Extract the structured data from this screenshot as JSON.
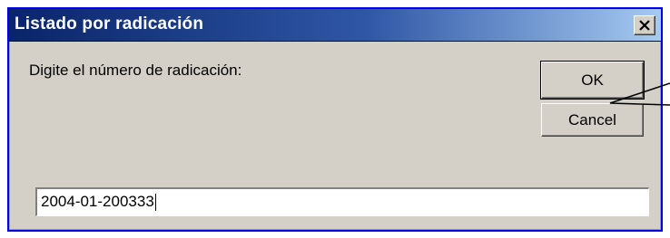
{
  "dialog": {
    "title": "Listado por radicación",
    "close_label": "Close",
    "prompt": "Digite el número de radicación:",
    "ok_label": "OK",
    "cancel_label": "Cancel",
    "input_value": "2004-01-200333"
  },
  "colors": {
    "title_bar_start": "#0a246a",
    "title_bar_end": "#a6caf0",
    "dialog_face": "#d4d0c8",
    "frame_border": "#0000f0"
  },
  "icons": {
    "close": "close-icon"
  }
}
